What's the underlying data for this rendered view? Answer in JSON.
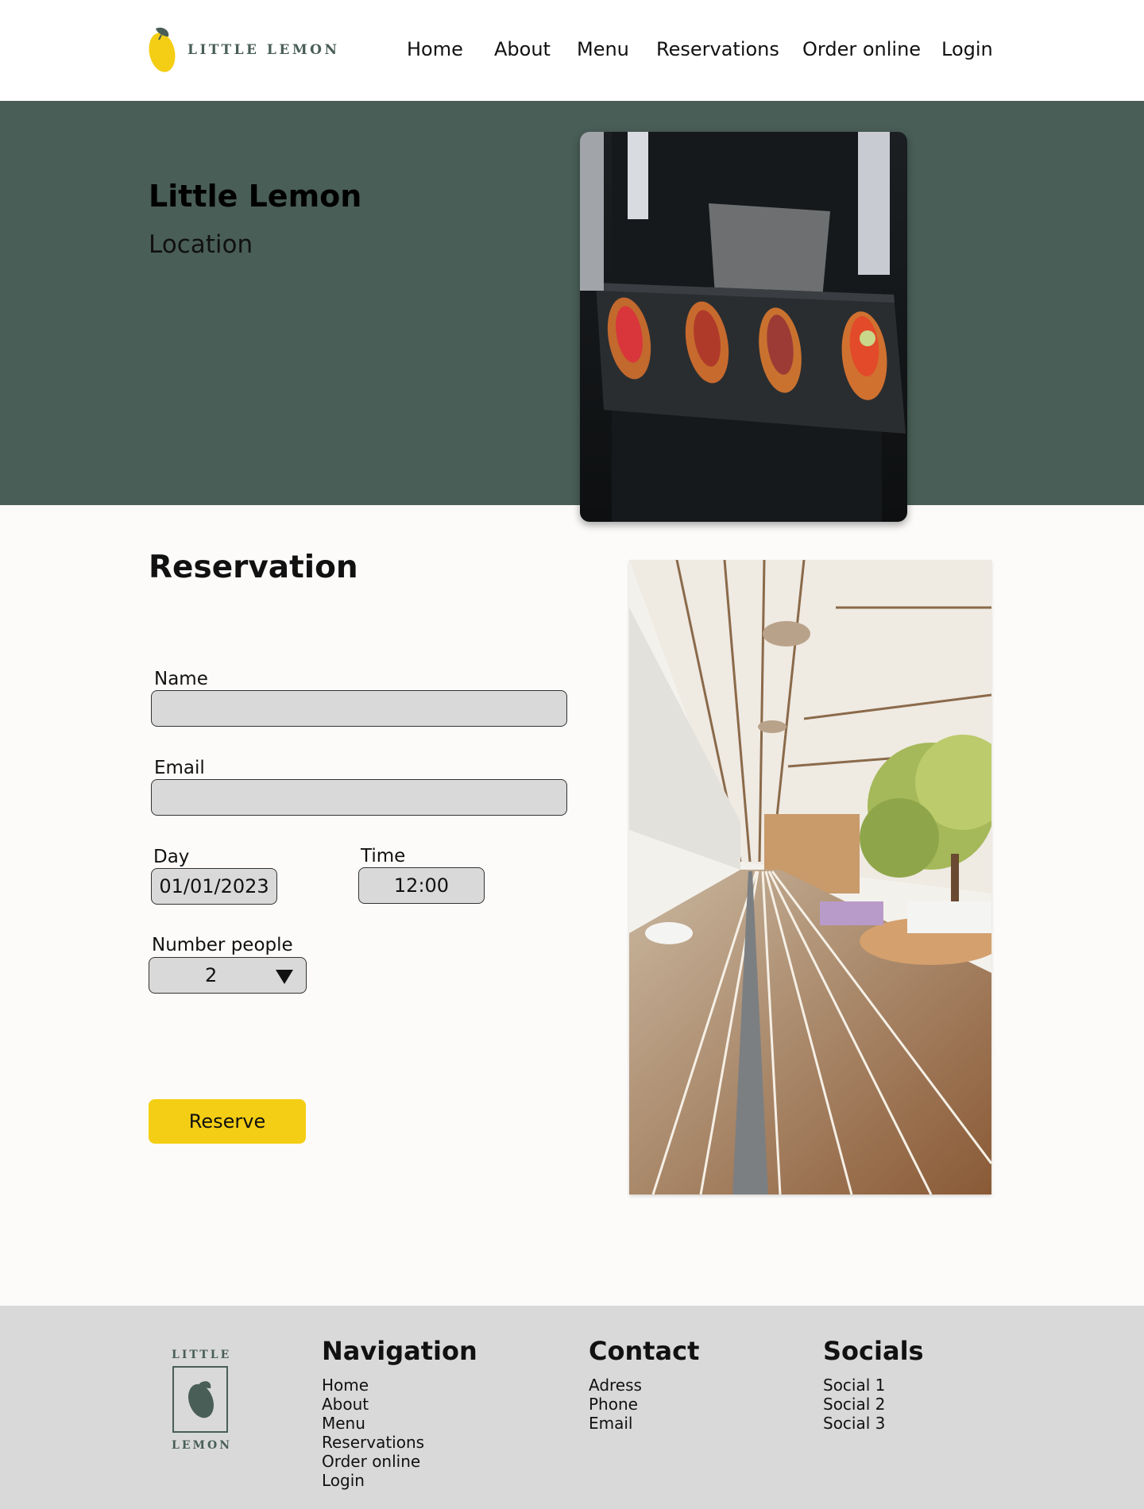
{
  "brand": {
    "name": "LITTLE LEMON",
    "footer_top": "LITTLE",
    "footer_bottom": "LEMON",
    "primary_color": "#495e57",
    "accent_color": "#f4ce14"
  },
  "nav": {
    "items": [
      "Home",
      "About",
      "Menu",
      "Reservations",
      "Order online",
      "Login"
    ]
  },
  "hero": {
    "title": "Little Lemon",
    "subtitle": "Location",
    "image_icon": "food-platter-photo"
  },
  "reservation": {
    "title": "Reservation",
    "name_label": "Name",
    "name_value": "",
    "email_label": "Email",
    "email_value": "",
    "day_label": "Day",
    "day_value": "01/01/2023",
    "time_label": "Time",
    "time_value": "12:00",
    "people_label": "Number people",
    "people_value": "2",
    "reserve_label": "Reserve",
    "side_image_icon": "restaurant-terrace-photo"
  },
  "footer": {
    "navigation": {
      "heading": "Navigation",
      "items": [
        "Home",
        "About",
        "Menu",
        "Reservations",
        "Order online",
        "Login"
      ]
    },
    "contact": {
      "heading": "Contact",
      "items": [
        "Adress",
        "Phone",
        "Email"
      ]
    },
    "socials": {
      "heading": "Socials",
      "items": [
        "Social 1",
        "Social 2",
        "Social 3"
      ]
    }
  }
}
